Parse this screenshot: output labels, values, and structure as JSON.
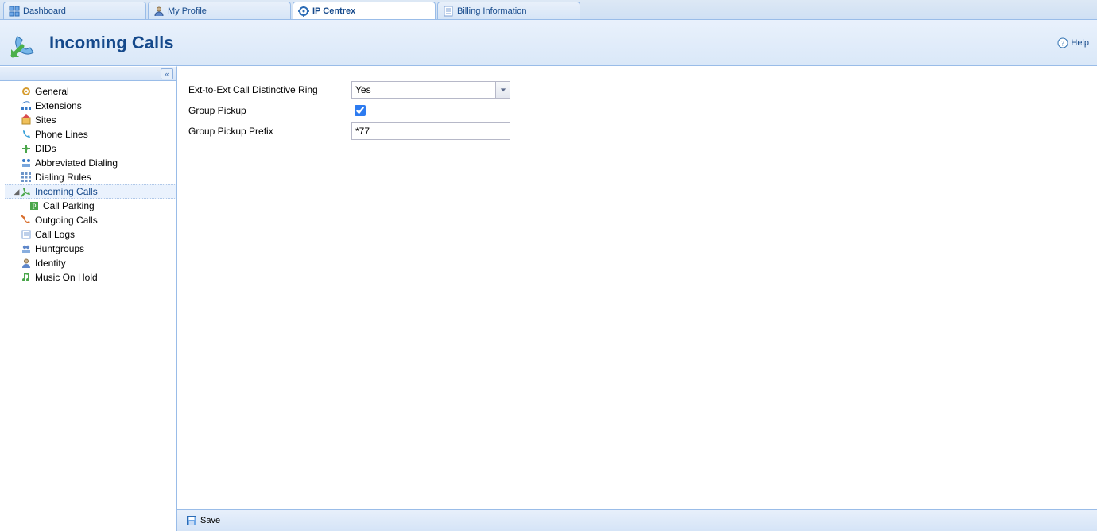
{
  "tabs": {
    "dashboard": "Dashboard",
    "my_profile": "My Profile",
    "ip_centrex": "IP Centrex",
    "billing_info": "Billing Information"
  },
  "header": {
    "title": "Incoming Calls",
    "help": "Help"
  },
  "sidebar": {
    "general": "General",
    "extensions": "Extensions",
    "sites": "Sites",
    "phone_lines": "Phone Lines",
    "dids": "DIDs",
    "abbrev_dialing": "Abbreviated Dialing",
    "dialing_rules": "Dialing Rules",
    "incoming_calls": "Incoming Calls",
    "call_parking": "Call Parking",
    "outgoing_calls": "Outgoing Calls",
    "call_logs": "Call Logs",
    "huntgroups": "Huntgroups",
    "identity": "Identity",
    "music_on_hold": "Music On Hold"
  },
  "form": {
    "distinctive_ring_label": "Ext-to-Ext Call Distinctive Ring",
    "distinctive_ring_value": "Yes",
    "group_pickup_label": "Group Pickup",
    "group_pickup_checked": true,
    "group_pickup_prefix_label": "Group Pickup Prefix",
    "group_pickup_prefix_value": "*77"
  },
  "footer": {
    "save": "Save"
  },
  "colors": {
    "accent": "#15498b",
    "border": "#99bce8"
  }
}
